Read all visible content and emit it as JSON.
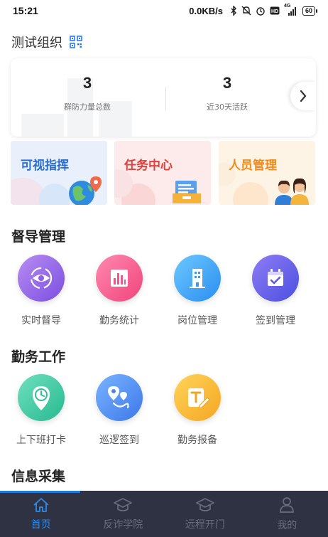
{
  "status_bar": {
    "time": "15:21",
    "net_speed": "0.0KB/s",
    "network_label": "4G",
    "battery": "60"
  },
  "org": {
    "name": "测试组织"
  },
  "stats": [
    {
      "value": "3",
      "label": "群防力量总数"
    },
    {
      "value": "3",
      "label": "近30天活跃"
    }
  ],
  "features": [
    {
      "label": "可视指挥",
      "color": "#2b6fd0"
    },
    {
      "label": "任务中心",
      "color": "#e0413c"
    },
    {
      "label": "人员管理",
      "color": "#f08c1e"
    }
  ],
  "sections": {
    "supervision": {
      "title": "督导管理",
      "items": [
        {
          "label": "实时督导",
          "icon": "eye-icon"
        },
        {
          "label": "勤务统计",
          "icon": "bar-chart-icon"
        },
        {
          "label": "岗位管理",
          "icon": "building-icon"
        },
        {
          "label": "签到管理",
          "icon": "calendar-check-icon"
        }
      ]
    },
    "duty": {
      "title": "勤务工作",
      "items": [
        {
          "label": "上下班打卡",
          "icon": "clock-pin-icon"
        },
        {
          "label": "巡逻签到",
          "icon": "route-icon"
        },
        {
          "label": "勤务报备",
          "icon": "report-edit-icon"
        }
      ]
    },
    "info": {
      "title": "信息采集"
    }
  },
  "tabs": [
    {
      "label": "首页",
      "icon": "home-icon",
      "active": true
    },
    {
      "label": "反诈学院",
      "icon": "graduation-cap-icon",
      "active": false
    },
    {
      "label": "远程开门",
      "icon": "graduation-cap-icon",
      "active": false
    },
    {
      "label": "我的",
      "icon": "user-icon",
      "active": false
    }
  ],
  "colors": {
    "tab_bg": "#2f3242",
    "tab_active": "#2f8bea",
    "accent": "#1e7ad6"
  }
}
